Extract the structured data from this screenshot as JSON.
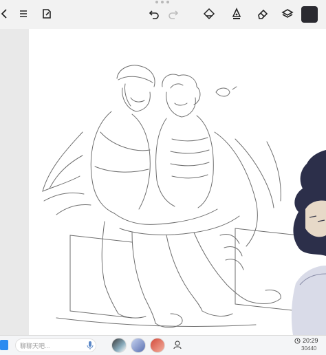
{
  "toolbar": {
    "buttons": [
      {
        "name": "back",
        "icon": "chevron-left-icon"
      },
      {
        "name": "menu",
        "icon": "hamburger-menu-icon"
      },
      {
        "name": "edit",
        "icon": "edit-note-icon"
      },
      {
        "name": "undo",
        "icon": "undo-icon"
      },
      {
        "name": "redo",
        "icon": "redo-icon"
      },
      {
        "name": "shapes",
        "icon": "shapes-icon"
      },
      {
        "name": "pen",
        "icon": "pen-nib-icon"
      },
      {
        "name": "eraser",
        "icon": "eraser-icon"
      },
      {
        "name": "layers",
        "icon": "layers-icon"
      }
    ],
    "current_color": "#2a2a30"
  },
  "bottom_bar": {
    "chat_placeholder": "聊聊天吧...",
    "time": "20:29",
    "count": "30440"
  }
}
